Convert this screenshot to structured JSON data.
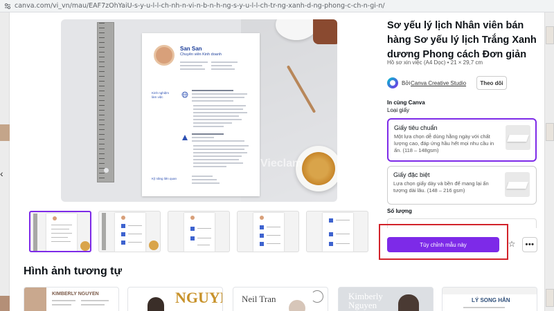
{
  "browser": {
    "url": "canva.com/vi_vn/mau/EAF7zOhYaiU-s-y-u-l-l-ch-nh-n-vi-n-b-n-h-ng-s-y-u-l-l-ch-tr-ng-xanh-d-ng-phong-c-ch-n-gi-n/"
  },
  "preview": {
    "watermark": "Vieclam",
    "cv": {
      "name": "San San",
      "title": "Chuyên viên Kinh doanh",
      "section_experience_1": "Kinh nghiệm",
      "section_experience_2": "làm việc",
      "section_skills": "Kỹ năng liên quan"
    }
  },
  "template": {
    "title": "Sơ yếu lý lịch Nhân viên bán hàng Sơ yếu lý lịch Trắng Xanh dương Phong cách Đơn giản",
    "meta": "Hồ sơ xin việc (A4 Dọc) • 21 × 29,7 cm",
    "creator_prefix": "Bởi",
    "creator_name": "Canva Creative Studio",
    "follow_label": "Theo dõi"
  },
  "print": {
    "section_title": "In cùng Canva",
    "paper_label": "Loại giấy",
    "options": [
      {
        "name": "Giấy tiêu chuẩn",
        "desc": "Một lựa chọn dễ dùng hằng ngày với chất lượng cao, đáp ứng hầu hết mọi nhu cầu in ấn. (118 – 148gsm)",
        "selected": true
      },
      {
        "name": "Giấy đặc biệt",
        "desc": "Lựa chọn giấy dày và bền để mang lại ấn tượng dài lâu. (148 – 216 gsm)",
        "selected": false
      }
    ],
    "quantity_label": "Số lượng"
  },
  "actions": {
    "customize_label": "Tùy chỉnh mẫu này",
    "star_icon": "☆",
    "more_icon": "•••"
  },
  "similar": {
    "title": "Hình ảnh tương tự",
    "cards": [
      "KIMBERLY NGUYEN",
      "NGUYỄN",
      "Neil Tran",
      "Kimberly Nguyen",
      "LÝ SONG HÂN"
    ]
  },
  "colors": {
    "accent": "#7d2ae8",
    "highlight": "#d2232a",
    "cv_blue": "#1d3f9a"
  }
}
